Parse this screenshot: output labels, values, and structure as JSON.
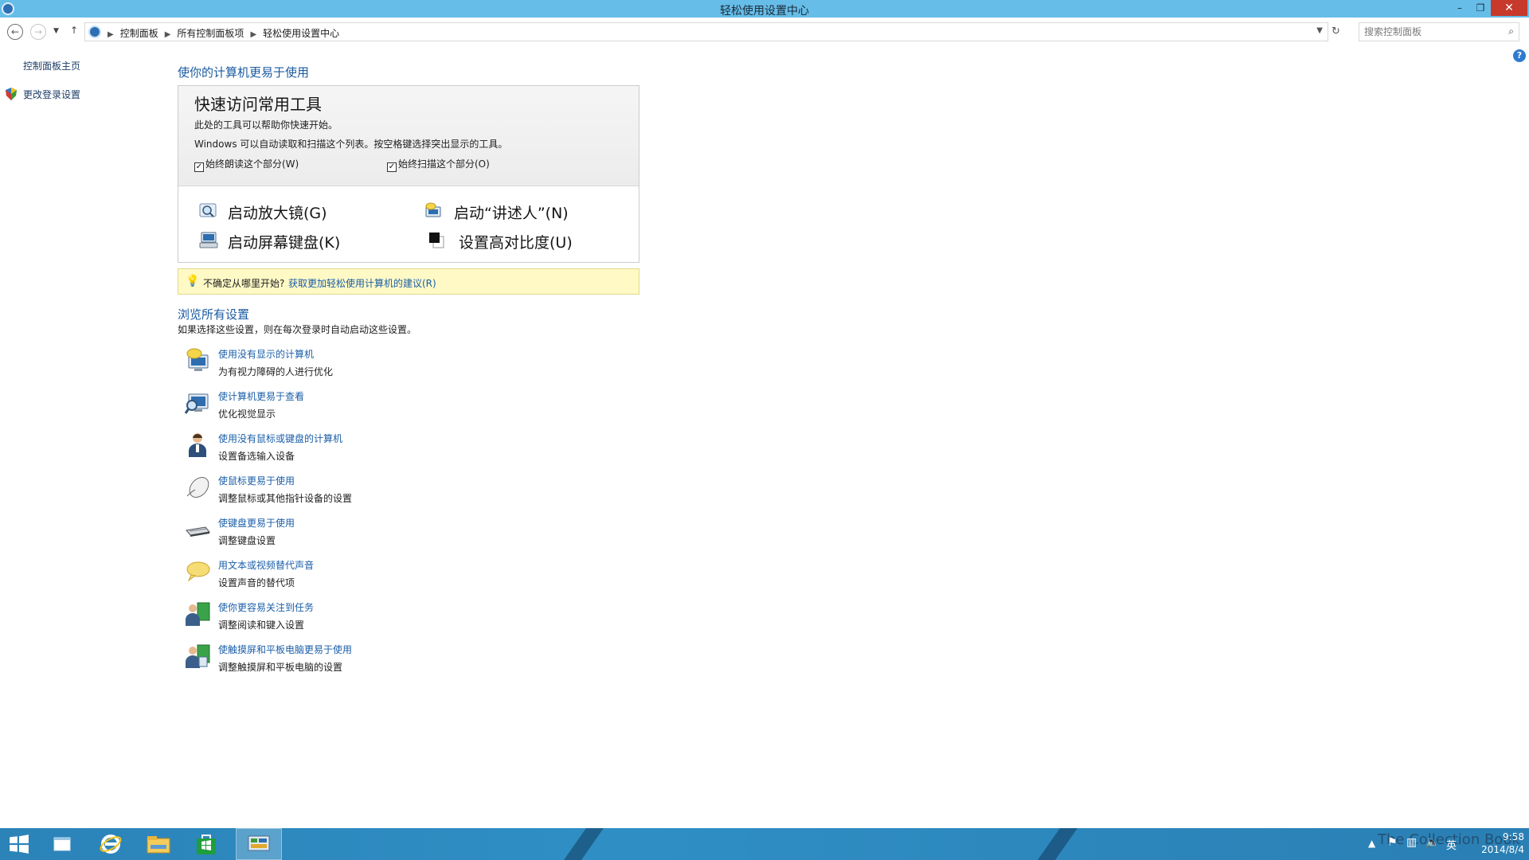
{
  "window": {
    "title": "轻松使用设置中心",
    "minimize_glyph": "–",
    "restore_glyph": "❐",
    "close_glyph": "✕"
  },
  "navigation": {
    "breadcrumbs": [
      "控制面板",
      "所有控制面板项",
      "轻松使用设置中心"
    ],
    "search_placeholder": "搜索控制面板"
  },
  "left_pane": {
    "home_link": "控制面板主页",
    "login_link": "更改登录设置"
  },
  "main": {
    "title": "使你的计算机更易于使用",
    "quick_access": {
      "title": "快速访问常用工具",
      "desc1": "此处的工具可以帮助你快速开始。",
      "desc2": "Windows 可以自动读取和扫描这个列表。按空格键选择突出显示的工具。",
      "checkbox_read": {
        "label": "始终朗读这个部分(W)",
        "checked": true
      },
      "checkbox_scan": {
        "label": "始终扫描这个部分(O)",
        "checked": true
      },
      "tools": [
        {
          "label": "启动放大镜(G)",
          "icon": "magnifier-icon"
        },
        {
          "label": "启动“讲述人”(N)",
          "icon": "narrator-icon"
        },
        {
          "label": "启动屏幕键盘(K)",
          "icon": "on-screen-keyboard-icon"
        },
        {
          "label": "设置高对比度(U)",
          "icon": "high-contrast-icon"
        }
      ]
    },
    "tip": {
      "question": "不确定从哪里开始?",
      "link": "获取更加轻松使用计算机的建议(R)"
    },
    "browse": {
      "title": "浏览所有设置",
      "desc": "如果选择这些设置，则在每次登录时自动启动这些设置。",
      "items": [
        {
          "link": "使用没有显示的计算机",
          "desc": "为有视力障碍的人进行优化",
          "icon": "computer-speech-icon"
        },
        {
          "link": "使计算机更易于查看",
          "desc": "优化视觉显示",
          "icon": "monitor-magnify-icon"
        },
        {
          "link": "使用没有鼠标或键盘的计算机",
          "desc": "设置备选输入设备",
          "icon": "person-icon"
        },
        {
          "link": "使鼠标更易于使用",
          "desc": "调整鼠标或其他指针设备的设置",
          "icon": "mouse-icon"
        },
        {
          "link": "使键盘更易于使用",
          "desc": "调整键盘设置",
          "icon": "keyboard-icon"
        },
        {
          "link": "用文本或视频替代声音",
          "desc": "设置声音的替代项",
          "icon": "speech-bubble-icon"
        },
        {
          "link": "使你更容易关注到任务",
          "desc": "调整阅读和键入设置",
          "icon": "person-task-icon"
        },
        {
          "link": "使触摸屏和平板电脑更易于使用",
          "desc": "调整触摸屏和平板电脑的设置",
          "icon": "person-tablet-icon"
        }
      ]
    }
  },
  "taskbar": {
    "apps": [
      "start-icon",
      "task-view-icon",
      "internet-explorer-icon",
      "file-explorer-icon",
      "store-icon",
      "control-panel-icon"
    ],
    "watermark": "The Collection Book",
    "ime": "英",
    "time": "9:58",
    "date": "2014/8/4"
  }
}
